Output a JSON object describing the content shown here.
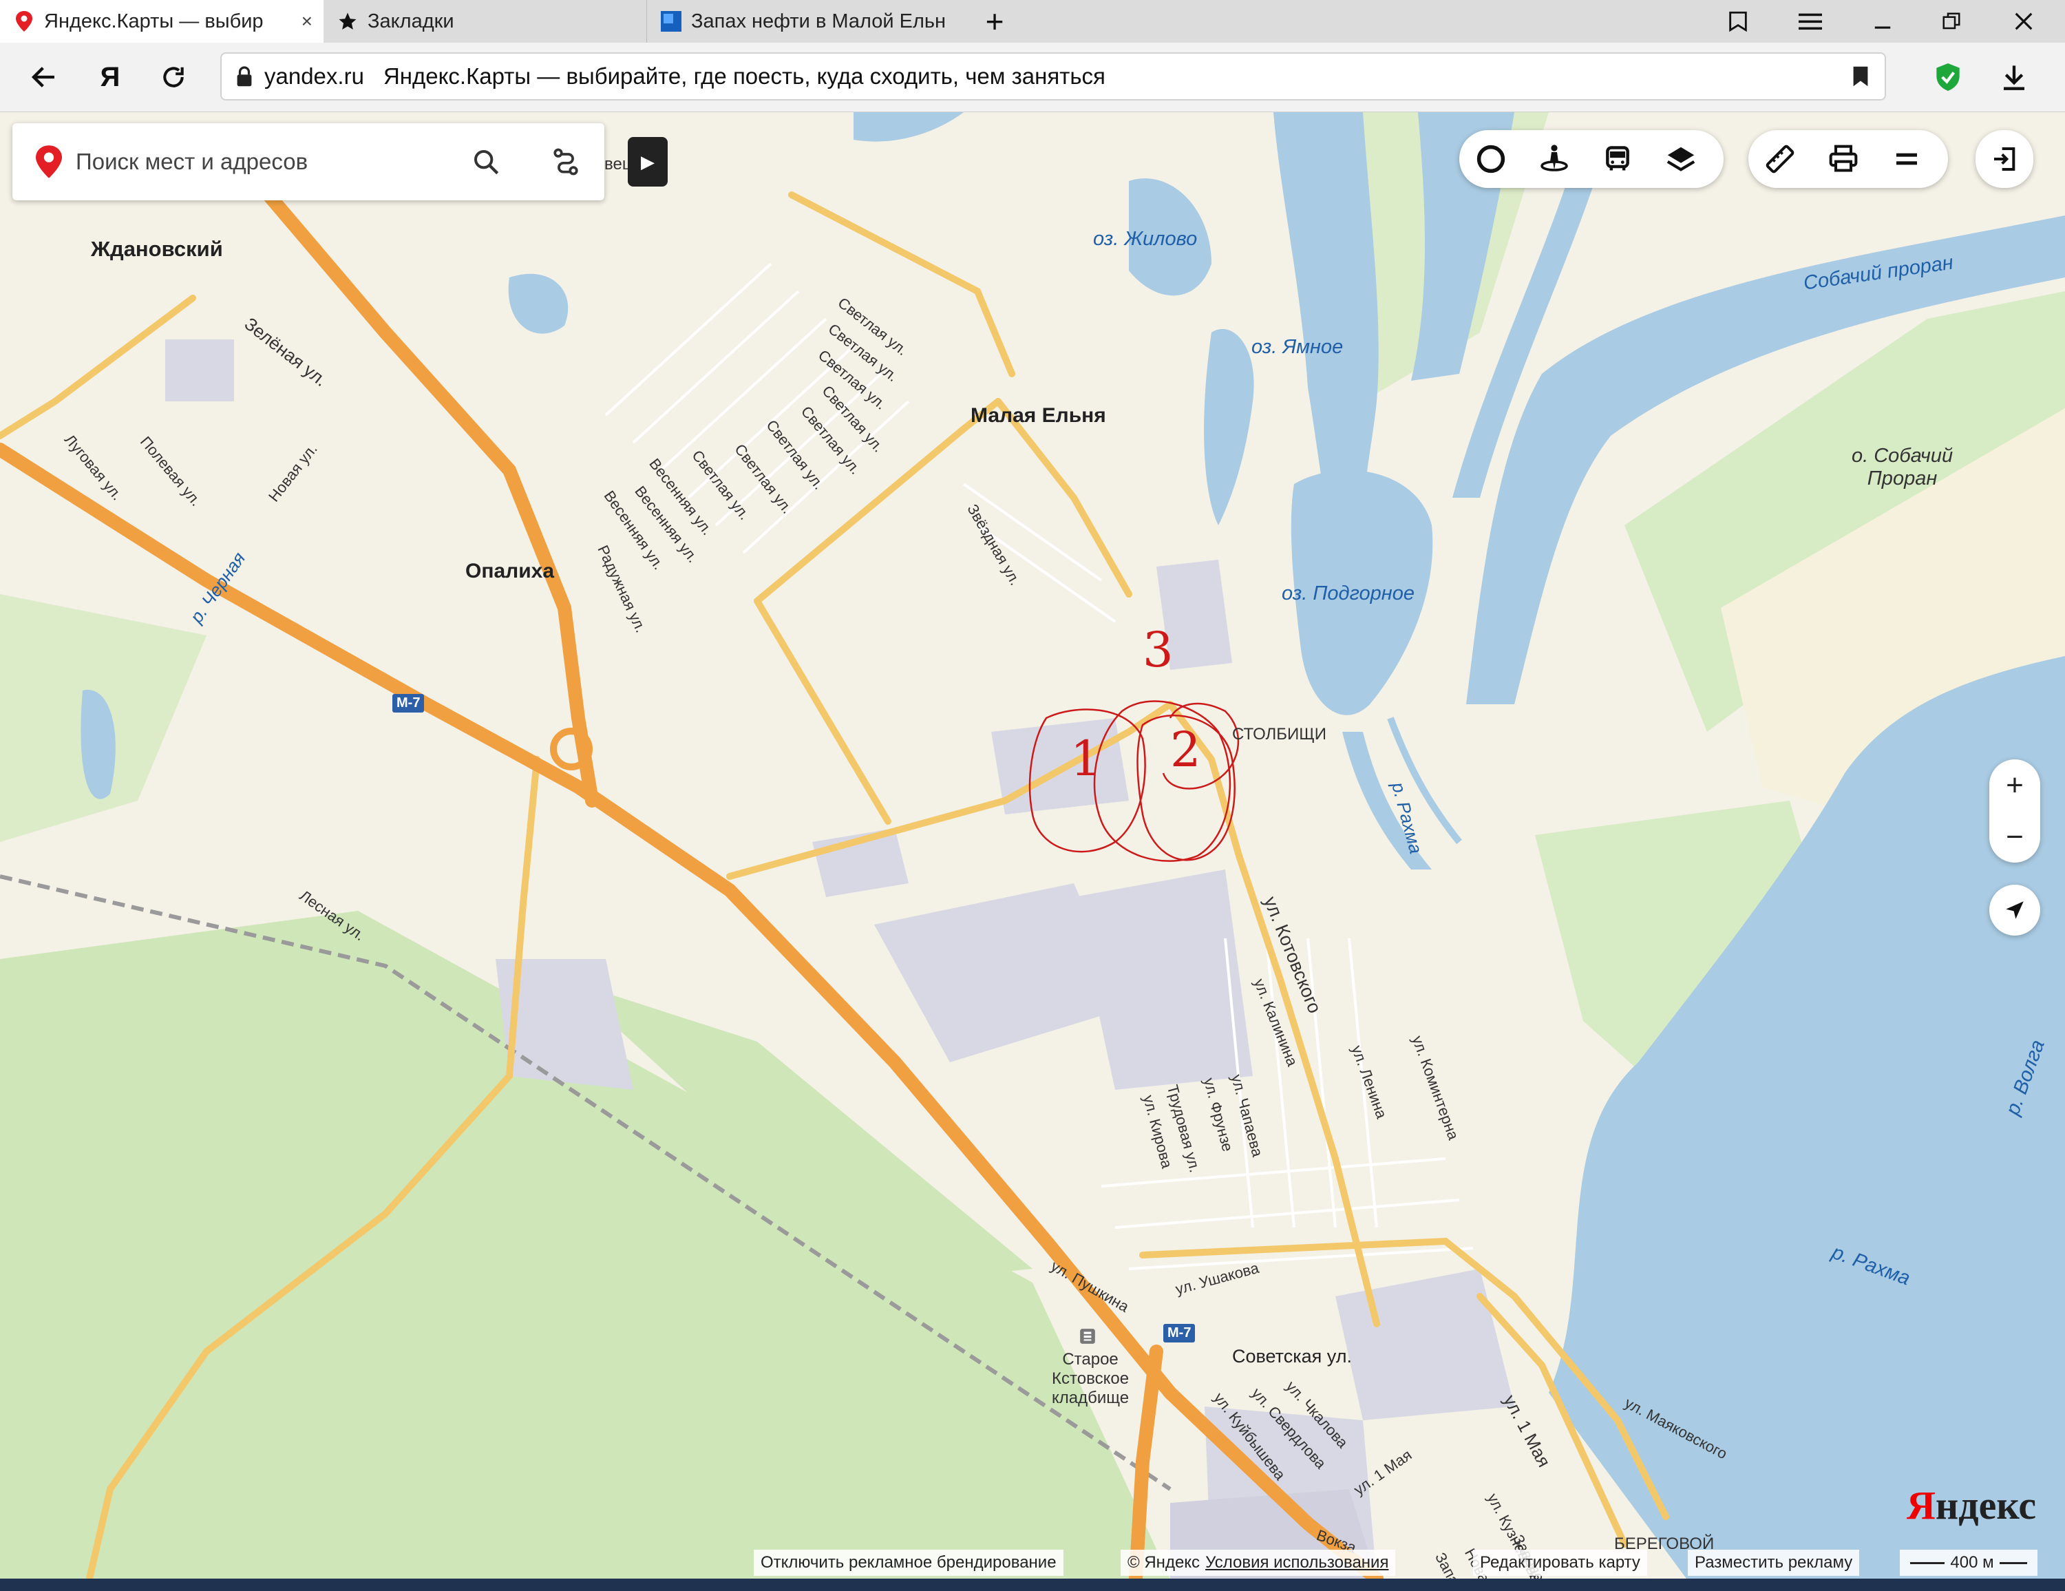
{
  "browser": {
    "tabs": [
      {
        "title": "Яндекс.Карты — выбир",
        "icon": "yandex-maps-pin-icon",
        "active": true
      },
      {
        "title": "Закладки",
        "icon": "star-icon",
        "active": false
      },
      {
        "title": "Запах нефти в Малой Ельн",
        "icon": "site-favicon",
        "active": false
      }
    ],
    "new_tab_label": "+",
    "close_tab_label": "×",
    "window_controls": [
      "bookmarks-icon",
      "menu-icon",
      "minimize-icon",
      "maximize-icon",
      "close-icon"
    ],
    "yandex_button_label": "Я",
    "address": {
      "domain": "yandex.ru",
      "page_title": "Яндекс.Карты — выбирайте, где поесть, куда сходить, чем заняться"
    },
    "colors": {
      "tabbar": "#dcdcdc",
      "active_tab": "#ffffff",
      "address_bg": "#f2f2f2",
      "shield_green": "#1ea83c"
    }
  },
  "map": {
    "search": {
      "placeholder": "Поиск мест и адресов"
    },
    "collapse_label": "▶",
    "toolbar_groups": [
      [
        "traffic-icon",
        "panorama-icon",
        "transport-icon",
        "layers-icon"
      ],
      [
        "ruler-icon",
        "print-icon",
        "more-icon"
      ]
    ],
    "login_icon": "login-icon",
    "zoom": {
      "plus": "+",
      "minus": "−"
    },
    "locate_icon": "geolocation-icon",
    "labels": {
      "zhdanovsky": "Ждановский",
      "malaya_elnya": "Малая Ельня",
      "opalikha": "Опалиха",
      "stolbishchi": "СТОЛБИЩИ",
      "sobachy_proran_island": "о. Собачий\nПроран",
      "lake_zhilovo": "оз. Жилово",
      "lake_yamnoe": "оз. Ямное",
      "lake_podgornoe": "оз. Подгорное",
      "sobachy_proran": "Собачий проран",
      "river_cherny": "р. Черная",
      "river_rakhma_1": "р. Рахма",
      "river_rakhma_2": "р. Рахма",
      "river_volga": "р. Волга",
      "zelenaya": "Зелёная ул.",
      "novaya": "Новая ул.",
      "polevaya": "Полевая ул.",
      "lugovaya": "Луговая ул.",
      "svetlaya": "Светлая ул.",
      "vesennyaya": "Весенняя ул.",
      "raduzhnaya": "Радужная ул.",
      "zvezdnaya": "Звёздная ул.",
      "lesnaya": "Лесная ул.",
      "kotovskogo": "ул. Котовского",
      "kalinina": "ул. Калинина",
      "lenina": "ул. Ленина",
      "kominterna": "ул. Коминтерна",
      "trudovaya": "Трудовая ул.",
      "kirova": "ул. Кирова",
      "frunze": "ул. Фрунзе",
      "chapaeva": "ул. Чапаева",
      "pushkina": "ул. Пушкина",
      "ushakova": "ул. Ушакова",
      "sovetskaya": "Советская ул.",
      "chkalova": "ул. Чкалова",
      "sverdlova": "ул. Свердлова",
      "kuybysheva": "ул. Куйбышева",
      "pervogo_maya_1": "ул. 1 Мая",
      "pervogo_maya_2": "ул. 1 Мая",
      "kuznetsova": "ул. Кузнецова",
      "mayakovskogo": "ул. Маяковского",
      "zavodskaya": "Заводская",
      "novaya_ul": "Новая ул.",
      "zapadnaya": "Западна",
      "vokzal": "Вокза",
      "beregovoy": "БЕРЕГОВОЙ",
      "cemetery": "Старое\nКстовское\nкладбище",
      "vec": "вец"
    },
    "route_shields": [
      "M-7",
      "M-7"
    ],
    "annotations": [
      "1",
      "2",
      "3"
    ],
    "annotation_color": "#cc1a1a",
    "colors": {
      "water": "#a9cbe3",
      "forest": "#cfe6b8",
      "highway": "#f0a040",
      "industrial": "#d8d8e4",
      "land": "#f4f1e6"
    },
    "footer": {
      "ad_toggle": "Отключить рекламное брендирование",
      "copyright": "© Яндекс",
      "terms": "Условия использования",
      "edit_map": "Редактировать карту",
      "advertise": "Разместить рекламу",
      "scale": "400 м"
    },
    "logo": {
      "first": "Я",
      "rest": "ндекс"
    }
  }
}
